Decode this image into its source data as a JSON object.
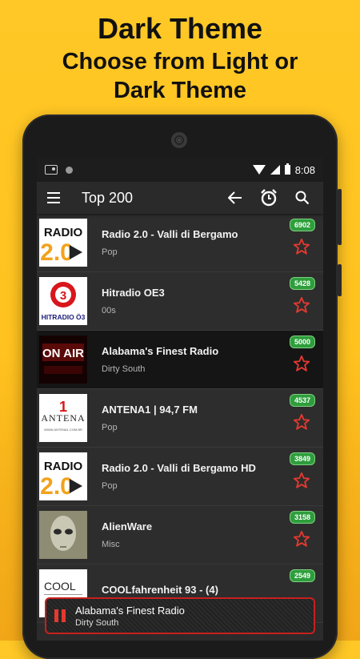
{
  "promo": {
    "line1": "Dark Theme",
    "line2": "Choose from Light or",
    "line3": "Dark Theme"
  },
  "statusbar": {
    "time": "8:08"
  },
  "appbar": {
    "title": "Top 200",
    "icons": [
      "menu-icon",
      "back-arrow-icon",
      "alarm-icon",
      "search-icon"
    ]
  },
  "stations": [
    {
      "name": "Radio 2.0 - Valli di Bergamo",
      "genre": "Pop",
      "count": "6902",
      "logo": "RADIO 2.0"
    },
    {
      "name": "Hitradio OE3",
      "genre": "00s",
      "count": "5428",
      "logo": "HITRADIO Ö3"
    },
    {
      "name": "Alabama's Finest Radio",
      "genre": "Dirty South",
      "count": "5000",
      "logo": "ON AIR"
    },
    {
      "name": "ANTENA1 | 94,7 FM",
      "genre": "Pop",
      "count": "4537",
      "logo": "ANTENA 1",
      "logo_sub": "WWW.ANTENA1.COM.BR"
    },
    {
      "name": "Radio 2.0 - Valli di Bergamo HD",
      "genre": "Pop",
      "count": "3849",
      "logo": "RADIO 2.0"
    },
    {
      "name": "AlienWare",
      "genre": "Misc",
      "count": "3158"
    },
    {
      "name": "COOLfahrenheit 93 - (4)",
      "genre": "",
      "count": "2549",
      "logo": "COOL"
    }
  ],
  "player": {
    "name": "Alabama's Finest Radio",
    "genre": "Dirty South"
  },
  "colors": {
    "accent": "#E5392F",
    "badge": "#2E9E3C",
    "background": "#FFC826"
  }
}
